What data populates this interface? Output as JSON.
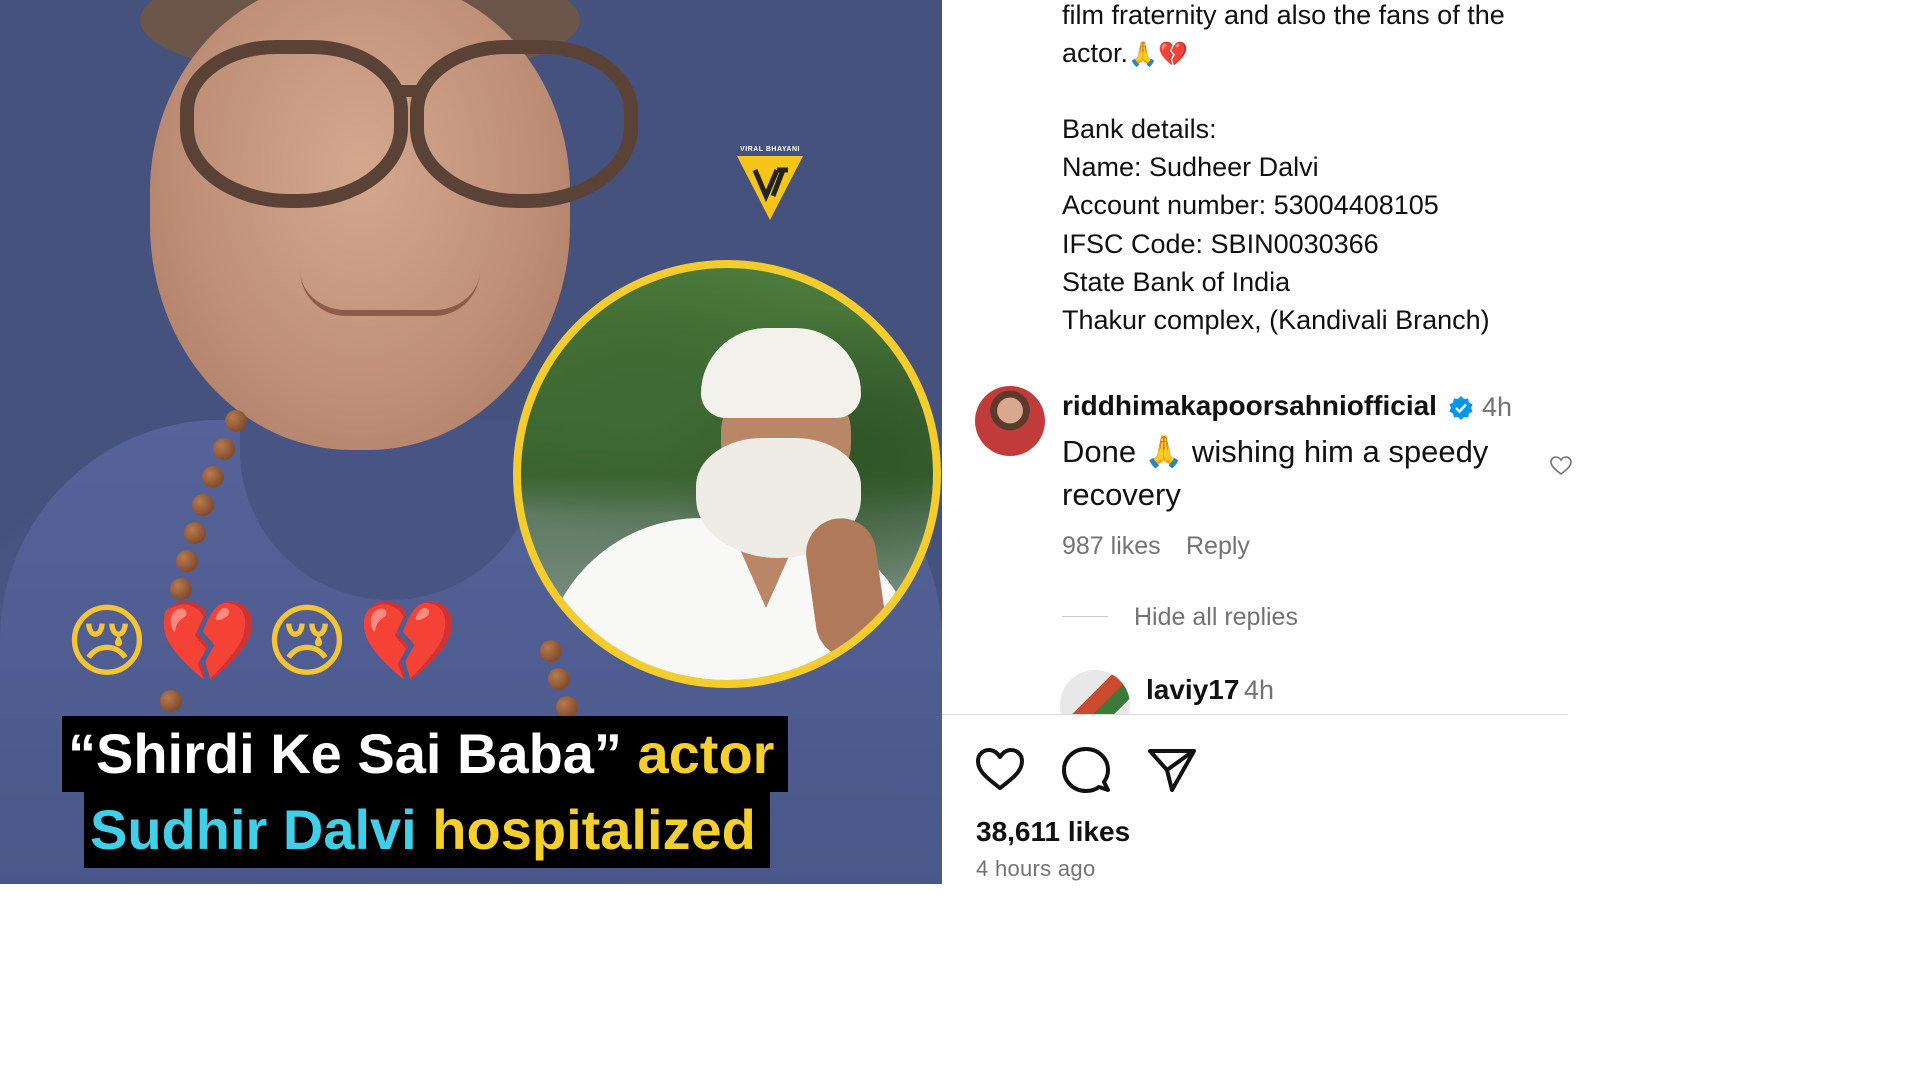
{
  "post_image": {
    "watermark": "VIRAL BHAYANI",
    "emojis": [
      "😢",
      "💔",
      "😢",
      "💔"
    ],
    "headline": {
      "line1_quote": "“Shirdi Ke Sai Baba”",
      "line1_rest": "actor",
      "line2_name": "Sudhir Dalvi",
      "line2_rest": "hospitalized"
    }
  },
  "caption": {
    "lines": [
      "film fraternity and also the fans of the",
      "actor.",
      "",
      "Bank details:",
      "Name: Sudheer Dalvi",
      "Account number: 53004408105",
      "IFSC Code: SBIN0030366",
      "State Bank of India",
      "Thakur complex, (Kandivali Branch)"
    ],
    "emoji_pray": "🙏",
    "emoji_heart": "💔"
  },
  "comment": {
    "username": "riddhimakapoorsahniofficial",
    "time": "4h",
    "text": "Done 🙏 wishing him a speedy recovery",
    "likes": "987 likes",
    "reply_label": "Reply",
    "hide_replies": "Hide all replies"
  },
  "reply": {
    "username": "laviy17",
    "time": "4h"
  },
  "actions": {
    "likes_count": "38,611 likes",
    "post_time": "4 hours ago"
  },
  "colors": {
    "headline_yellow": "#f5cf2c",
    "headline_cyan": "#3fd0e8",
    "inset_border": "#f4cd2d",
    "verified_blue": "#0095f6",
    "muted_text": "#737373"
  }
}
